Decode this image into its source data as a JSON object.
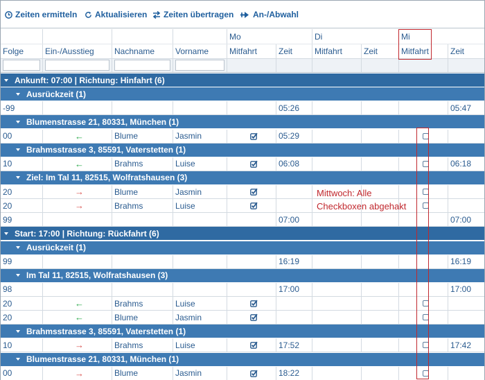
{
  "toolbar": {
    "calc_times": "Zeiten ermitteln",
    "refresh": "Aktualisieren",
    "transfer_times": "Zeiten übertragen",
    "arrival_departure": "An-/Abwahl"
  },
  "columns": {
    "day_mo": "Mo",
    "day_di": "Di",
    "day_mi": "Mi",
    "folge": "Folge",
    "ein_ausstieg": "Ein-/Ausstieg",
    "nachname": "Nachname",
    "vorname": "Vorname",
    "mitfahrt": "Mitfahrt",
    "zeit": "Zeit"
  },
  "rows": [
    {
      "kind": "grp1",
      "label": "Ankunft: 07:00 | Richtung: Hinfahrt (6)"
    },
    {
      "kind": "grp2",
      "label": "Ausrückzeit (1)"
    },
    {
      "kind": "data",
      "folge": "-99",
      "arrow": "",
      "nachname": "",
      "vorname": "",
      "mo_check": false,
      "mo_zeit": "05:26",
      "mi_box": false,
      "mi_zeit": "05:47"
    },
    {
      "kind": "grp2",
      "label": "Blumenstrasse 21, 80331, München (1)"
    },
    {
      "kind": "data",
      "folge": "00",
      "arrow": "green",
      "nachname": "Blume",
      "vorname": "Jasmin",
      "mo_check": true,
      "mo_zeit": "05:29",
      "mi_box": true,
      "mi_zeit": ""
    },
    {
      "kind": "grp2",
      "label": "Brahmsstrasse 3, 85591, Vaterstetten (1)"
    },
    {
      "kind": "data",
      "folge": "10",
      "arrow": "green",
      "nachname": "Brahms",
      "vorname": "Luise",
      "mo_check": true,
      "mo_zeit": "06:08",
      "mi_box": true,
      "mi_zeit": "06:18"
    },
    {
      "kind": "grp2",
      "label": "Ziel: Im Tal 11, 82515, Wolfratshausen (3)"
    },
    {
      "kind": "data",
      "folge": "20",
      "arrow": "red",
      "nachname": "Blume",
      "vorname": "Jasmin",
      "mo_check": true,
      "mo_zeit": "",
      "mi_box": true,
      "mi_zeit": ""
    },
    {
      "kind": "data",
      "folge": "20",
      "arrow": "red",
      "nachname": "Brahms",
      "vorname": "Luise",
      "mo_check": true,
      "mo_zeit": "",
      "mi_box": true,
      "mi_zeit": ""
    },
    {
      "kind": "data",
      "folge": "99",
      "arrow": "",
      "nachname": "",
      "vorname": "",
      "mo_check": false,
      "mo_zeit": "07:00",
      "mi_box": false,
      "mi_zeit": "07:00"
    },
    {
      "kind": "grp1",
      "label": "Start: 17:00 | Richtung: Rückfahrt (6)"
    },
    {
      "kind": "grp2",
      "label": "Ausrückzeit (1)"
    },
    {
      "kind": "data",
      "folge": "99",
      "arrow": "",
      "nachname": "",
      "vorname": "",
      "mo_check": false,
      "mo_zeit": "16:19",
      "mi_box": false,
      "mi_zeit": "16:19"
    },
    {
      "kind": "grp2",
      "label": "Im Tal 11, 82515, Wolfratshausen (3)"
    },
    {
      "kind": "data",
      "folge": "98",
      "arrow": "",
      "nachname": "",
      "vorname": "",
      "mo_check": false,
      "mo_zeit": "17:00",
      "mi_box": false,
      "mi_zeit": "17:00"
    },
    {
      "kind": "data",
      "folge": "20",
      "arrow": "green",
      "nachname": "Brahms",
      "vorname": "Luise",
      "mo_check": true,
      "mo_zeit": "",
      "mi_box": true,
      "mi_zeit": ""
    },
    {
      "kind": "data",
      "folge": "20",
      "arrow": "green",
      "nachname": "Blume",
      "vorname": "Jasmin",
      "mo_check": true,
      "mo_zeit": "",
      "mi_box": true,
      "mi_zeit": ""
    },
    {
      "kind": "grp2",
      "label": "Brahmsstrasse 3, 85591, Vaterstetten (1)"
    },
    {
      "kind": "data",
      "folge": "10",
      "arrow": "red",
      "nachname": "Brahms",
      "vorname": "Luise",
      "mo_check": true,
      "mo_zeit": "17:52",
      "mi_box": true,
      "mi_zeit": "17:42"
    },
    {
      "kind": "grp2",
      "label": "Blumenstrasse 21, 80331, München (1)"
    },
    {
      "kind": "data",
      "folge": "00",
      "arrow": "red",
      "nachname": "Blume",
      "vorname": "Jasmin",
      "mo_check": true,
      "mo_zeit": "18:22",
      "mi_box": true,
      "mi_zeit": ""
    }
  ],
  "annotation": {
    "line1": "Mittwoch: Alle",
    "line2": "Checkboxen abgehakt"
  },
  "colors": {
    "group_dark": "#2f6aa2",
    "group_light": "#3e7ab3",
    "annotation_red": "#c0272d",
    "arrow_green": "#2aa84a",
    "arrow_red": "#d9534f"
  },
  "icons": {
    "calc_times": "clock-icon",
    "refresh": "refresh-icon",
    "transfer_times": "transfer-arrows-icon",
    "arrival_departure": "pin-arrow-icon"
  }
}
